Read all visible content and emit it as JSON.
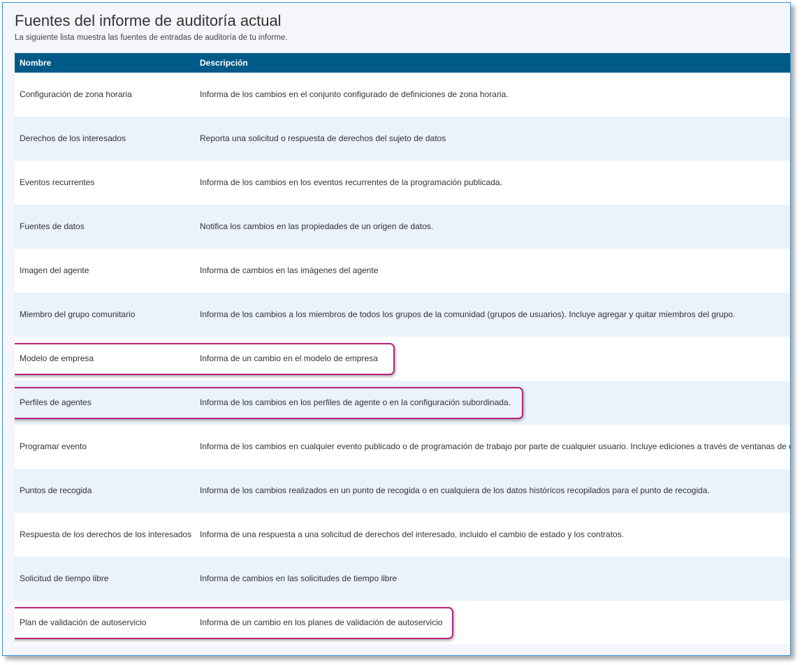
{
  "header": {
    "title": "Fuentes del informe de auditoría actual",
    "subtitle": "La siguiente lista muestra las fuentes de entradas de auditoría de tu informe."
  },
  "table": {
    "columns": [
      "Nombre",
      "Descripción"
    ],
    "rows": [
      {
        "name": "Configuración de zona horaria",
        "description": "Informa de los cambios en el conjunto configurado de definiciones de zona horaria.",
        "highlighted": false
      },
      {
        "name": "Derechos de los interesados",
        "description": "Reporta una solicitud o respuesta de derechos del sujeto de datos",
        "highlighted": false
      },
      {
        "name": "Eventos recurrentes",
        "description": "Informa de los cambios en los eventos recurrentes de la programación publicada.",
        "highlighted": false
      },
      {
        "name": "Fuentes de datos",
        "description": "Notifica los cambios en las propiedades de un origen de datos.",
        "highlighted": false
      },
      {
        "name": "Imagen del agente",
        "description": "Informa de cambios en las imágenes del agente",
        "highlighted": false
      },
      {
        "name": "Miembro del grupo comunitario",
        "description": "Informa de los cambios a los miembros de todos los grupos de la comunidad (grupos de usuarios). Incluye agregar y quitar miembros del grupo.",
        "highlighted": false
      },
      {
        "name": "Modelo de empresa",
        "description": "Informa de un cambio en el modelo de empresa",
        "highlighted": true
      },
      {
        "name": "Perfiles de agentes",
        "description": "Informa de los cambios en los perfiles de agente o en la configuración subordinada.",
        "highlighted": true
      },
      {
        "name": "Programar evento",
        "description": "Informa de los cambios en cualquier evento publicado o de programación de trabajo por parte de cualquier usuario. Incluye ediciones a través de ventanas de d",
        "highlighted": false
      },
      {
        "name": "Puntos de recogida",
        "description": "Informa de los cambios realizados en un punto de recogida o en cualquiera de los datos históricos recopilados para el punto de recogida.",
        "highlighted": false
      },
      {
        "name": "Respuesta de los derechos de los interesados",
        "description": "Informa de una respuesta a una solicitud de derechos del interesado, incluido el cambio de estado y los contratos.",
        "highlighted": false
      },
      {
        "name": "Solicitud de tiempo libre",
        "description": "Informa de cambios en las solicitudes de tiempo libre",
        "highlighted": false
      },
      {
        "name": "Plan de validación de autoservicio",
        "description": "Informa de un cambio en los planes de validación de autoservicio",
        "highlighted": true
      }
    ]
  },
  "colors": {
    "header_bg": "#005a87",
    "row_alt_bg": "#eaf2fb",
    "highlight_border": "#b5247d",
    "frame_border": "#3a8fd6"
  }
}
